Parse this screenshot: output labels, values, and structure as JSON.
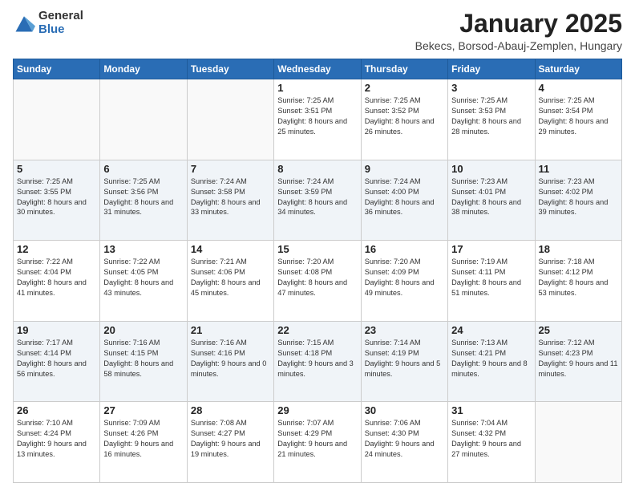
{
  "logo": {
    "general": "General",
    "blue": "Blue"
  },
  "title": {
    "month": "January 2025",
    "location": "Bekecs, Borsod-Abauj-Zemplen, Hungary"
  },
  "days_header": [
    "Sunday",
    "Monday",
    "Tuesday",
    "Wednesday",
    "Thursday",
    "Friday",
    "Saturday"
  ],
  "weeks": [
    [
      {
        "day": "",
        "info": ""
      },
      {
        "day": "",
        "info": ""
      },
      {
        "day": "",
        "info": ""
      },
      {
        "day": "1",
        "info": "Sunrise: 7:25 AM\nSunset: 3:51 PM\nDaylight: 8 hours\nand 25 minutes."
      },
      {
        "day": "2",
        "info": "Sunrise: 7:25 AM\nSunset: 3:52 PM\nDaylight: 8 hours\nand 26 minutes."
      },
      {
        "day": "3",
        "info": "Sunrise: 7:25 AM\nSunset: 3:53 PM\nDaylight: 8 hours\nand 28 minutes."
      },
      {
        "day": "4",
        "info": "Sunrise: 7:25 AM\nSunset: 3:54 PM\nDaylight: 8 hours\nand 29 minutes."
      }
    ],
    [
      {
        "day": "5",
        "info": "Sunrise: 7:25 AM\nSunset: 3:55 PM\nDaylight: 8 hours\nand 30 minutes."
      },
      {
        "day": "6",
        "info": "Sunrise: 7:25 AM\nSunset: 3:56 PM\nDaylight: 8 hours\nand 31 minutes."
      },
      {
        "day": "7",
        "info": "Sunrise: 7:24 AM\nSunset: 3:58 PM\nDaylight: 8 hours\nand 33 minutes."
      },
      {
        "day": "8",
        "info": "Sunrise: 7:24 AM\nSunset: 3:59 PM\nDaylight: 8 hours\nand 34 minutes."
      },
      {
        "day": "9",
        "info": "Sunrise: 7:24 AM\nSunset: 4:00 PM\nDaylight: 8 hours\nand 36 minutes."
      },
      {
        "day": "10",
        "info": "Sunrise: 7:23 AM\nSunset: 4:01 PM\nDaylight: 8 hours\nand 38 minutes."
      },
      {
        "day": "11",
        "info": "Sunrise: 7:23 AM\nSunset: 4:02 PM\nDaylight: 8 hours\nand 39 minutes."
      }
    ],
    [
      {
        "day": "12",
        "info": "Sunrise: 7:22 AM\nSunset: 4:04 PM\nDaylight: 8 hours\nand 41 minutes."
      },
      {
        "day": "13",
        "info": "Sunrise: 7:22 AM\nSunset: 4:05 PM\nDaylight: 8 hours\nand 43 minutes."
      },
      {
        "day": "14",
        "info": "Sunrise: 7:21 AM\nSunset: 4:06 PM\nDaylight: 8 hours\nand 45 minutes."
      },
      {
        "day": "15",
        "info": "Sunrise: 7:20 AM\nSunset: 4:08 PM\nDaylight: 8 hours\nand 47 minutes."
      },
      {
        "day": "16",
        "info": "Sunrise: 7:20 AM\nSunset: 4:09 PM\nDaylight: 8 hours\nand 49 minutes."
      },
      {
        "day": "17",
        "info": "Sunrise: 7:19 AM\nSunset: 4:11 PM\nDaylight: 8 hours\nand 51 minutes."
      },
      {
        "day": "18",
        "info": "Sunrise: 7:18 AM\nSunset: 4:12 PM\nDaylight: 8 hours\nand 53 minutes."
      }
    ],
    [
      {
        "day": "19",
        "info": "Sunrise: 7:17 AM\nSunset: 4:14 PM\nDaylight: 8 hours\nand 56 minutes."
      },
      {
        "day": "20",
        "info": "Sunrise: 7:16 AM\nSunset: 4:15 PM\nDaylight: 8 hours\nand 58 minutes."
      },
      {
        "day": "21",
        "info": "Sunrise: 7:16 AM\nSunset: 4:16 PM\nDaylight: 9 hours\nand 0 minutes."
      },
      {
        "day": "22",
        "info": "Sunrise: 7:15 AM\nSunset: 4:18 PM\nDaylight: 9 hours\nand 3 minutes."
      },
      {
        "day": "23",
        "info": "Sunrise: 7:14 AM\nSunset: 4:19 PM\nDaylight: 9 hours\nand 5 minutes."
      },
      {
        "day": "24",
        "info": "Sunrise: 7:13 AM\nSunset: 4:21 PM\nDaylight: 9 hours\nand 8 minutes."
      },
      {
        "day": "25",
        "info": "Sunrise: 7:12 AM\nSunset: 4:23 PM\nDaylight: 9 hours\nand 11 minutes."
      }
    ],
    [
      {
        "day": "26",
        "info": "Sunrise: 7:10 AM\nSunset: 4:24 PM\nDaylight: 9 hours\nand 13 minutes."
      },
      {
        "day": "27",
        "info": "Sunrise: 7:09 AM\nSunset: 4:26 PM\nDaylight: 9 hours\nand 16 minutes."
      },
      {
        "day": "28",
        "info": "Sunrise: 7:08 AM\nSunset: 4:27 PM\nDaylight: 9 hours\nand 19 minutes."
      },
      {
        "day": "29",
        "info": "Sunrise: 7:07 AM\nSunset: 4:29 PM\nDaylight: 9 hours\nand 21 minutes."
      },
      {
        "day": "30",
        "info": "Sunrise: 7:06 AM\nSunset: 4:30 PM\nDaylight: 9 hours\nand 24 minutes."
      },
      {
        "day": "31",
        "info": "Sunrise: 7:04 AM\nSunset: 4:32 PM\nDaylight: 9 hours\nand 27 minutes."
      },
      {
        "day": "",
        "info": ""
      }
    ]
  ]
}
